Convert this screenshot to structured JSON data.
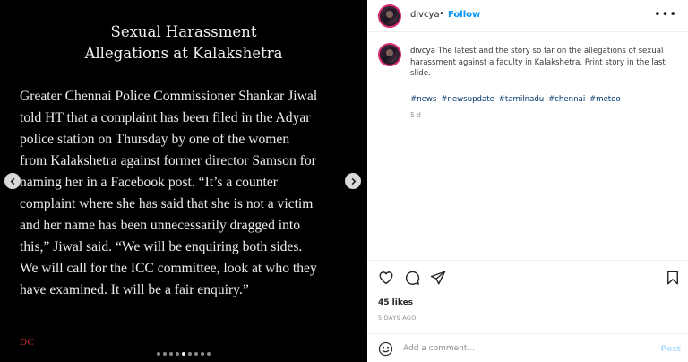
{
  "media": {
    "title_lines": [
      "Sexual Harassment",
      "Allegations at Kalakshetra"
    ],
    "body_lines": [
      "Greater Chennai Police Commissioner Shankar Jiwal",
      "told HT that a complaint has been filed in the Adyar",
      "police station on Thursday by one of the women",
      "from Kalakshetra against former director Samson for",
      "naming her in a Facebook post. “It’s a counter",
      "complaint where she has said that she is not a victim",
      "and her name has been unnecessarily dragged into",
      "this,” Jiwal said. “We will be enquiring both sides.",
      "We will call for the ICC committee, look at who they",
      "have examined. It will be a fair enquiry.”"
    ],
    "logo_text": "DC",
    "slide_count": 9,
    "active_slide": 4
  },
  "header": {
    "username": "divcya",
    "separator": "•",
    "follow_label": "Follow",
    "more_label": "•••"
  },
  "caption": {
    "username": "divcya",
    "text": "The latest and the story so far on the allegations of sexual harassment against a faculty in Kalakshetra. Print story in the last slide.",
    "hashtags": [
      "#news",
      "#newsupdate",
      "#tamilnadu",
      "#chennai",
      "#metoo"
    ],
    "age": "5 d"
  },
  "actions": {
    "icons": [
      "heart-icon",
      "comment-icon",
      "share-icon",
      "bookmark-icon"
    ],
    "likes": "45 likes",
    "date": "5 DAYS AGO"
  },
  "composer": {
    "placeholder": "Add a comment...",
    "post_label": "Post"
  },
  "colors": {
    "accent": "#0095f6",
    "post_disabled": "#b2dffc",
    "hashtag": "#00376b",
    "logo": "#d0342c"
  }
}
